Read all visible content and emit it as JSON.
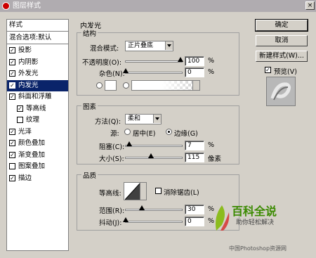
{
  "window": {
    "title": "图层样式",
    "close_glyph": "×"
  },
  "sidebar": {
    "header": "样式",
    "blend_label": "混合选项:默认",
    "items": [
      {
        "label": "投影",
        "checked": true,
        "selected": false,
        "indent": false
      },
      {
        "label": "内阴影",
        "checked": true,
        "selected": false,
        "indent": false
      },
      {
        "label": "外发光",
        "checked": true,
        "selected": false,
        "indent": false
      },
      {
        "label": "内发光",
        "checked": true,
        "selected": true,
        "indent": false
      },
      {
        "label": "斜面和浮雕",
        "checked": true,
        "selected": false,
        "indent": false
      },
      {
        "label": "等高线",
        "checked": true,
        "selected": false,
        "indent": true
      },
      {
        "label": "纹理",
        "checked": false,
        "selected": false,
        "indent": true
      },
      {
        "label": "光泽",
        "checked": true,
        "selected": false,
        "indent": false
      },
      {
        "label": "颜色叠加",
        "checked": true,
        "selected": false,
        "indent": false
      },
      {
        "label": "渐变叠加",
        "checked": true,
        "selected": false,
        "indent": false
      },
      {
        "label": "图案叠加",
        "checked": false,
        "selected": false,
        "indent": false
      },
      {
        "label": "描边",
        "checked": true,
        "selected": false,
        "indent": false
      }
    ]
  },
  "panel": {
    "title": "内发光",
    "structure": {
      "legend": "结构",
      "blend_mode_label": "混合模式:",
      "blend_mode_value": "正片叠底",
      "opacity_label": "不透明度(O):",
      "opacity_value": "100",
      "opacity_fraction": 1.0,
      "noise_label": "杂色(N):",
      "noise_value": "0",
      "noise_fraction": 0.0,
      "percent": "%",
      "color_radio_on": false,
      "gradient_radio_on": false,
      "color_swatch": "#ffffff"
    },
    "elements": {
      "legend": "图素",
      "method_label": "方法(Q):",
      "method_value": "柔和",
      "source_label": "源:",
      "source_center": "居中(E)",
      "source_edge": "边缘(G)",
      "source_selected": "edge",
      "choke_label": "阻塞(C):",
      "choke_value": "7",
      "choke_fraction": 0.07,
      "size_label": "大小(S):",
      "size_value": "115",
      "size_fraction": 0.46,
      "percent": "%",
      "pixels": "像素"
    },
    "quality": {
      "legend": "品质",
      "contour_label": "等高线:",
      "antialias_label": "消除锯齿(L)",
      "antialias_checked": false,
      "range_label": "范围(R):",
      "range_value": "30",
      "range_fraction": 0.3,
      "jitter_label": "抖动(J):",
      "jitter_value": "0",
      "jitter_fraction": 0.0,
      "percent": "%"
    }
  },
  "buttons": {
    "ok": "确定",
    "cancel": "取消",
    "new_style": "新建样式(W)...",
    "preview_label": "预览(V)",
    "preview_checked": true
  },
  "watermark": {
    "brand": "百科全说",
    "tagline": "助你轻松解决",
    "site": "中国Photoshop资源网"
  }
}
